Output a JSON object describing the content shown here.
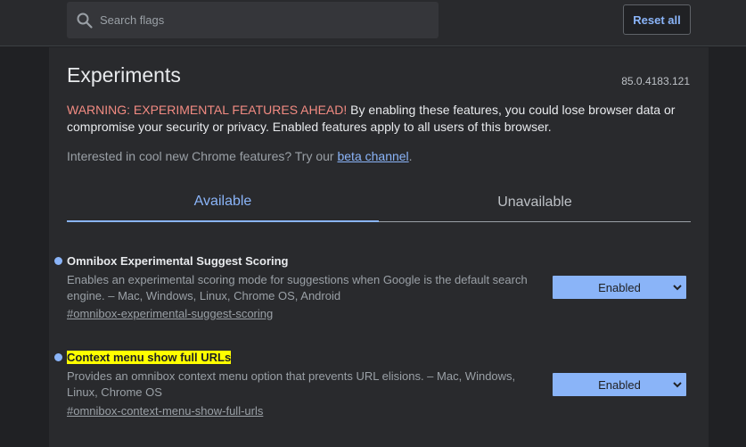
{
  "header": {
    "search_placeholder": "Search flags",
    "reset_label": "Reset all"
  },
  "page": {
    "title": "Experiments",
    "version": "85.0.4183.121",
    "warning_prefix": "WARNING: EXPERIMENTAL FEATURES AHEAD!",
    "warning_text": " By enabling these features, you could lose browser data or compromise your security or privacy. Enabled features apply to all users of this browser.",
    "interest_text": "Interested in cool new Chrome features? Try our ",
    "interest_link": "beta channel",
    "interest_suffix": "."
  },
  "tabs": [
    {
      "label": "Available",
      "active": true
    },
    {
      "label": "Unavailable",
      "active": false
    }
  ],
  "experiments": [
    {
      "name": "Omnibox Experimental Suggest Scoring",
      "description": "Enables an experimental scoring mode for suggestions when Google is the default search engine. – Mac, Windows, Linux, Chrome OS, Android",
      "link": "#omnibox-experimental-suggest-scoring",
      "value": "Enabled"
    },
    {
      "name": "Context menu show full URLs",
      "description": "Provides an omnibox context menu option that prevents URL elisions. – Mac, Windows, Linux, Chrome OS",
      "link": "#omnibox-context-menu-show-full-urls",
      "value": "Enabled"
    }
  ],
  "colors": {
    "accent": "#8ab4f8",
    "warning": "#f28b82",
    "highlight": "#ffff00",
    "background": "#202124"
  }
}
